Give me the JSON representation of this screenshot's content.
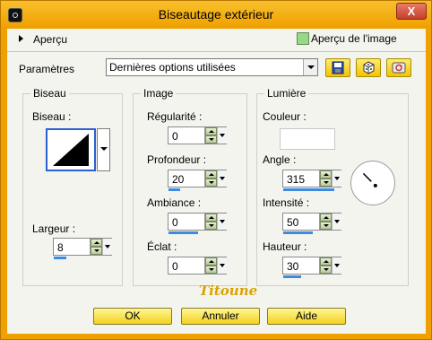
{
  "window": {
    "title": "Biseautage extérieur",
    "close_label": "X"
  },
  "preview": {
    "toggle_label": "Aperçu",
    "image_preview_label": "Aperçu de l'image",
    "image_preview_checked": true
  },
  "presets": {
    "label": "Paramètres",
    "value": "Dernières options utilisées"
  },
  "bevel": {
    "group_title": "Biseau",
    "bevel_label": "Biseau :",
    "width_label": "Largeur :",
    "width_value": "8"
  },
  "image": {
    "group_title": "Image",
    "smoothness_label": "Régularité :",
    "smoothness_value": "0",
    "depth_label": "Profondeur :",
    "depth_value": "20",
    "ambience_label": "Ambiance :",
    "ambience_value": "0",
    "shininess_label": "Éclat :",
    "shininess_value": "0"
  },
  "light": {
    "group_title": "Lumière",
    "color_label": "Couleur :",
    "color": "#ffffff",
    "angle_label": "Angle :",
    "angle_value": "315",
    "intensity_label": "Intensité :",
    "intensity_value": "50",
    "elevation_label": "Hauteur :",
    "elevation_value": "30"
  },
  "watermark": "Titoune",
  "buttons": {
    "ok": "OK",
    "cancel": "Annuler",
    "help": "Aide"
  },
  "colors": {
    "title_bar": "#f0a000",
    "button_face": "#f3d21e",
    "close_button": "#c2402c",
    "slider_track": "#3c8be0"
  }
}
